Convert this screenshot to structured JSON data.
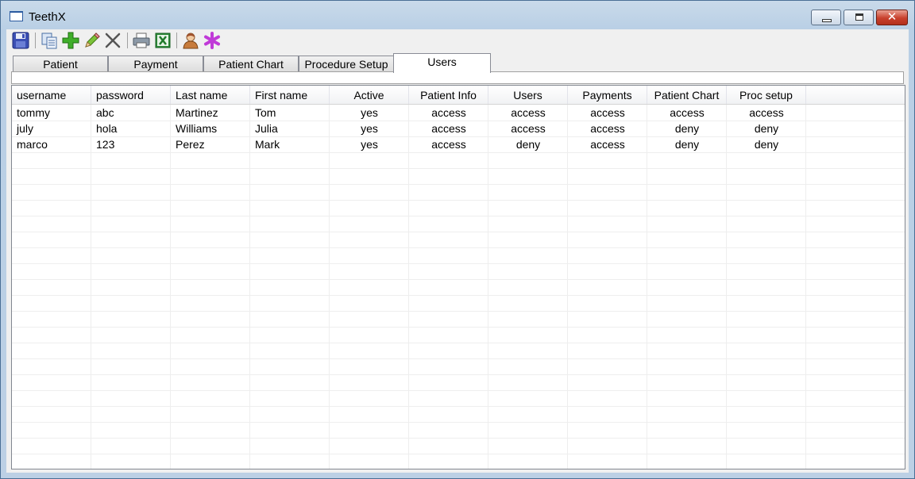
{
  "window": {
    "title": "TeethX",
    "controls": [
      "minimize",
      "maximize",
      "close"
    ]
  },
  "toolbar": {
    "buttons": [
      {
        "name": "save-icon"
      },
      {
        "name": "copy-icon"
      },
      {
        "name": "add-icon"
      },
      {
        "name": "edit-icon"
      },
      {
        "name": "delete-icon"
      },
      {
        "name": "print-icon"
      },
      {
        "name": "excel-export-icon"
      },
      {
        "name": "user-icon"
      },
      {
        "name": "asterisk-icon"
      }
    ]
  },
  "tabs": [
    {
      "label": "Patient",
      "active": false
    },
    {
      "label": "Payment",
      "active": false
    },
    {
      "label": "Patient Chart",
      "active": false
    },
    {
      "label": "Procedure Setup",
      "active": false
    },
    {
      "label": "Users",
      "active": true
    }
  ],
  "grid": {
    "columns": [
      "username",
      "password",
      "Last name",
      "First name",
      "Active",
      "Patient Info",
      "Users",
      "Payments",
      "Patient Chart",
      "Proc setup"
    ],
    "rows": [
      [
        "tommy",
        "abc",
        "Martinez",
        "Tom",
        "yes",
        "access",
        "access",
        "access",
        "access",
        "access"
      ],
      [
        "july",
        "hola",
        "Williams",
        "Julia",
        "yes",
        "access",
        "access",
        "access",
        "deny",
        "deny"
      ],
      [
        "marco",
        "123",
        "Perez",
        "Mark",
        "yes",
        "access",
        "deny",
        "access",
        "deny",
        "deny"
      ]
    ]
  },
  "colors": {
    "title_bar": "#c9daea",
    "close_button": "#c8402c",
    "client_bg": "#f0f0f0",
    "grid_bg": "#ffffff"
  }
}
